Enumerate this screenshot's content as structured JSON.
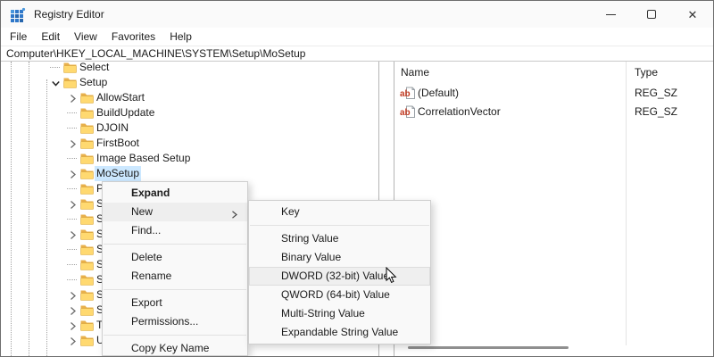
{
  "window": {
    "title": "Registry Editor",
    "controls": [
      {
        "name": "minimize-button",
        "icon": "minimize-icon"
      },
      {
        "name": "maximize-button",
        "icon": "maximize-icon"
      },
      {
        "name": "close-button",
        "icon": "close-icon"
      }
    ]
  },
  "menubar": [
    "File",
    "Edit",
    "View",
    "Favorites",
    "Help"
  ],
  "address": "Computer\\HKEY_LOCAL_MACHINE\\SYSTEM\\Setup\\MoSetup",
  "tree": {
    "items": [
      {
        "label": "Select",
        "level": 3,
        "expander": "none",
        "selected": false
      },
      {
        "label": "Setup",
        "level": 3,
        "expander": "expanded",
        "selected": false
      },
      {
        "label": "AllowStart",
        "level": 4,
        "expander": "collapsed",
        "selected": false
      },
      {
        "label": "BuildUpdate",
        "level": 4,
        "expander": "none",
        "selected": false
      },
      {
        "label": "DJOIN",
        "level": 4,
        "expander": "none",
        "selected": false
      },
      {
        "label": "FirstBoot",
        "level": 4,
        "expander": "collapsed",
        "selected": false
      },
      {
        "label": "Image Based Setup",
        "level": 4,
        "expander": "none",
        "selected": false
      },
      {
        "label": "MoSetup",
        "level": 4,
        "expander": "collapsed",
        "selected": true
      },
      {
        "label": "P",
        "level": 4,
        "expander": "none",
        "selected": false
      },
      {
        "label": "S",
        "level": 4,
        "expander": "collapsed",
        "selected": false
      },
      {
        "label": "S",
        "level": 4,
        "expander": "none",
        "selected": false
      },
      {
        "label": "S",
        "level": 4,
        "expander": "collapsed",
        "selected": false
      },
      {
        "label": "S",
        "level": 4,
        "expander": "none",
        "selected": false
      },
      {
        "label": "S",
        "level": 4,
        "expander": "none",
        "selected": false
      },
      {
        "label": "S",
        "level": 4,
        "expander": "none",
        "selected": false
      },
      {
        "label": "S",
        "level": 4,
        "expander": "collapsed",
        "selected": false
      },
      {
        "label": "S",
        "level": 4,
        "expander": "collapsed",
        "selected": false
      },
      {
        "label": "T",
        "level": 4,
        "expander": "collapsed",
        "selected": false
      },
      {
        "label": "U",
        "level": 4,
        "expander": "collapsed",
        "selected": false
      }
    ]
  },
  "context_menu": {
    "items": [
      {
        "label": "Expand",
        "bold": true
      },
      {
        "label": "New",
        "submenu": true,
        "hover": true
      },
      {
        "label": "Find..."
      },
      {
        "type": "separator"
      },
      {
        "label": "Delete"
      },
      {
        "label": "Rename"
      },
      {
        "type": "separator"
      },
      {
        "label": "Export"
      },
      {
        "label": "Permissions..."
      },
      {
        "type": "separator"
      },
      {
        "label": "Copy Key Name"
      }
    ]
  },
  "new_submenu": {
    "items": [
      {
        "label": "Key"
      },
      {
        "type": "separator"
      },
      {
        "label": "String Value"
      },
      {
        "label": "Binary Value"
      },
      {
        "label": "DWORD (32-bit) Value",
        "hover": true
      },
      {
        "label": "QWORD (64-bit) Value"
      },
      {
        "label": "Multi-String Value"
      },
      {
        "label": "Expandable String Value"
      }
    ]
  },
  "value_list": {
    "columns": [
      "Name",
      "Type"
    ],
    "rows": [
      {
        "name": "(Default)",
        "type": "REG_SZ",
        "icon": "string-value-icon"
      },
      {
        "name": "CorrelationVector",
        "type": "REG_SZ",
        "icon": "string-value-icon"
      }
    ]
  },
  "colors": {
    "selection": "#cce8ff",
    "menu_hover": "#eeeeee",
    "folder": "#ffd261",
    "value_icon_text": "#c23b22"
  }
}
